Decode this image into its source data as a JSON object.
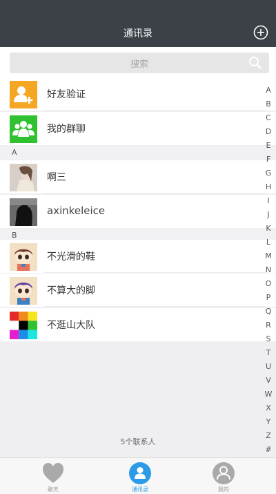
{
  "nav": {
    "title": "通讯录"
  },
  "search": {
    "placeholder": "搜索"
  },
  "special_items": [
    {
      "label": "好友验证",
      "icon": "add-friend-icon",
      "color": "#f5a623"
    },
    {
      "label": "我的群聊",
      "icon": "group-icon",
      "color": "#2fc12f"
    }
  ],
  "sections": [
    {
      "letter": "A",
      "contacts": [
        {
          "name": "啊三"
        },
        {
          "name": "axinkeleice"
        }
      ]
    },
    {
      "letter": "B",
      "contacts": [
        {
          "name": "不光滑的鞋"
        },
        {
          "name": "不算大的脚"
        },
        {
          "name": "不逛山大队"
        }
      ]
    }
  ],
  "index_letters": [
    "A",
    "B",
    "C",
    "D",
    "E",
    "F",
    "G",
    "H",
    "I",
    "J",
    "K",
    "L",
    "M",
    "N",
    "O",
    "P",
    "Q",
    "R",
    "S",
    "T",
    "U",
    "V",
    "W",
    "X",
    "Y",
    "Z",
    "#"
  ],
  "footer": {
    "count_text": "5个联系人"
  },
  "tabs": [
    {
      "label": "聊天",
      "icon": "heart-icon"
    },
    {
      "label": "通讯录",
      "icon": "contacts-icon",
      "active": true
    },
    {
      "label": "我的",
      "icon": "profile-icon"
    }
  ],
  "colors": {
    "header": "#3c4047",
    "accent": "#2b9be8"
  }
}
